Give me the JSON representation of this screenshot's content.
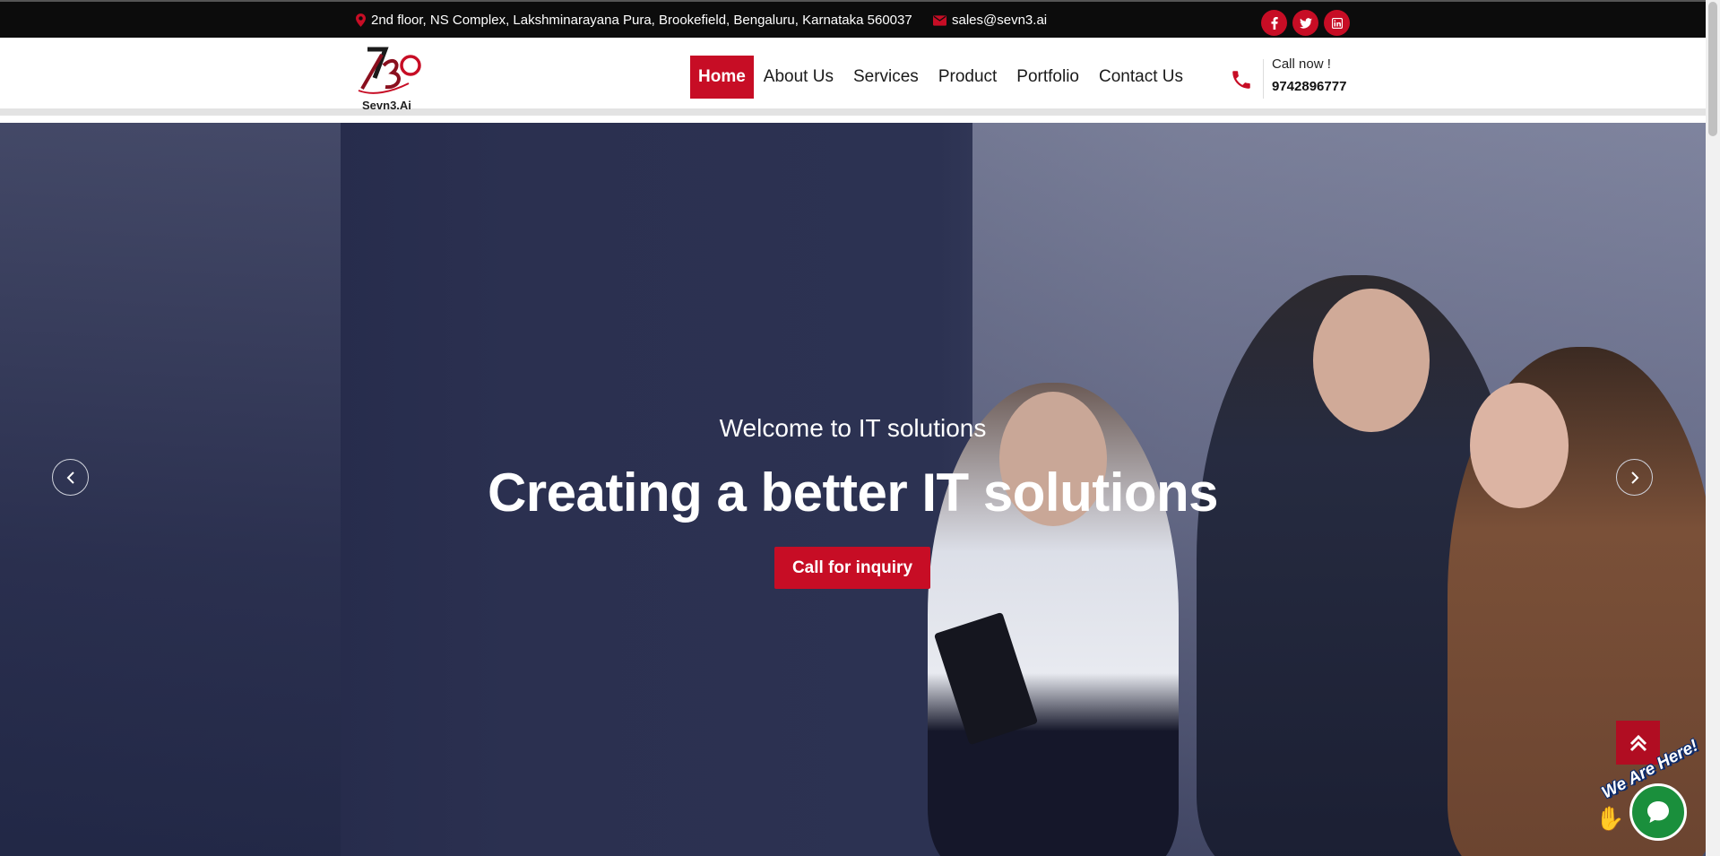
{
  "topbar": {
    "address": "2nd floor, NS Complex, Lakshminarayana Pura, Brookefield, Bengaluru, Karnataka 560037",
    "email": "sales@sevn3.ai",
    "socials": [
      "facebook-icon",
      "twitter-icon",
      "linkedin-icon"
    ]
  },
  "header": {
    "logo_text": "Sevn3.Ai",
    "nav": [
      "Home",
      "About Us",
      "Services",
      "Product",
      "Portfolio",
      "Contact Us"
    ],
    "active_nav": "Home",
    "call_label": "Call now !",
    "phone": "9742896777"
  },
  "hero": {
    "subtitle": "Welcome to IT solutions",
    "title": "Creating a better IT solutions",
    "cta": "Call for inquiry"
  },
  "chat": {
    "badge_text": "We Are Here!"
  },
  "colors": {
    "accent": "#c70d25",
    "topbar_bg": "#0c0c0c",
    "hero_overlay": "#2b3050",
    "chat_green": "#1a8f3c"
  }
}
